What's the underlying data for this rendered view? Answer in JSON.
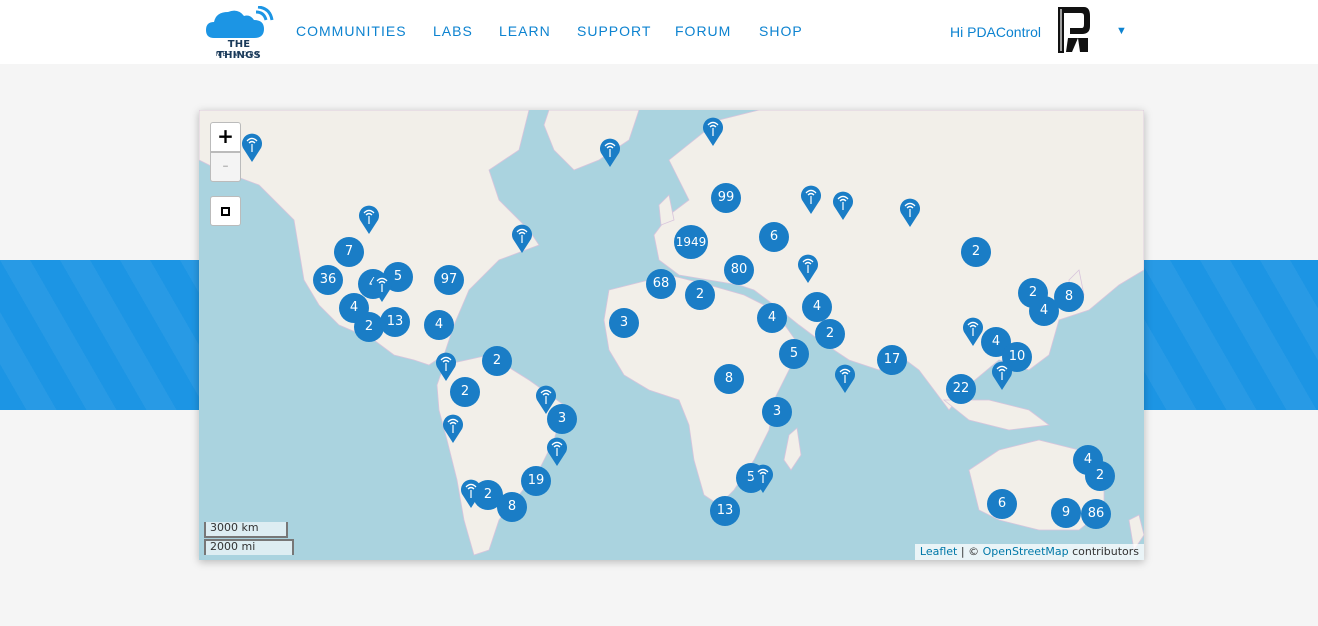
{
  "header": {
    "logo_line1": "THE THINGS",
    "logo_line2": "NETWORK",
    "nav": [
      "COMMUNITIES",
      "LABS",
      "LEARN",
      "SUPPORT",
      "FORUM",
      "SHOP"
    ],
    "greeting": "Hi PDAControl",
    "caret": "▼"
  },
  "map": {
    "zoom_in": "+",
    "zoom_out": "-",
    "clusters": [
      "99",
      "6",
      "1949",
      "80",
      "68",
      "2",
      "7",
      "36",
      "4",
      "5",
      "97",
      "4",
      "2",
      "13",
      "4",
      "2",
      "2",
      "3",
      "3",
      "4",
      "2",
      "4",
      "5",
      "8",
      "17",
      "2",
      "2",
      "8",
      "4",
      "4",
      "10",
      "22",
      "3",
      "19",
      "2",
      "8",
      "5",
      "13",
      "4",
      "2",
      "6",
      "9",
      "86"
    ],
    "scale_km": "3000 km",
    "scale_mi": "2000 mi",
    "attribution": {
      "leaflet": "Leaflet",
      "separator": " | © ",
      "osm": "OpenStreetMap",
      "suffix": " contributors"
    }
  },
  "colors": {
    "brand_blue": "#0d83d0",
    "band_blue": "#1c95e4",
    "cluster_blue": "#1a7dc6",
    "water": "#aad3df",
    "land": "#f2efe9"
  }
}
